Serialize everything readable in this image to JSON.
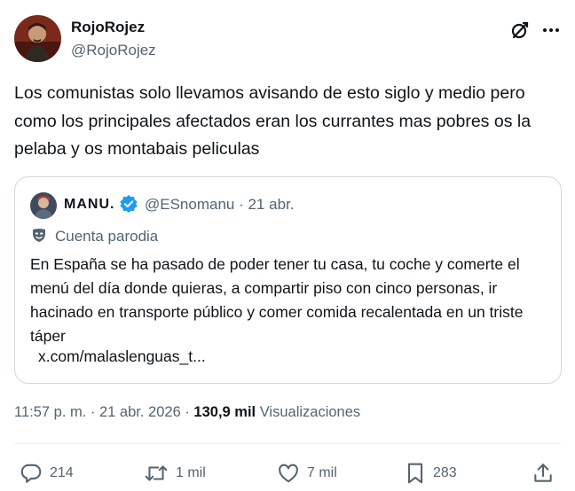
{
  "tweet": {
    "author": {
      "display_name": "RojoRojez",
      "handle": "@RojoRojez"
    },
    "text": "Los comunistas solo llevamos avisando de esto siglo y medio pero como los principales afectados eran los currantes mas pobres os la pelaba y os montabais peliculas",
    "quoted": {
      "display_name": "MANU.",
      "handle_time": "@ESnomanu · 21 abr.",
      "parody_label": "Cuenta parodia",
      "text": "En España se ha pasado de poder tener tu casa, tu coche y comerte el menú del día donde quieras, a compartir piso con cinco personas, ir hacinado en transporte público y comer comida recalentada en un triste táper",
      "link": "x.com/malaslenguas_t..."
    },
    "meta": {
      "time": "11:57 p. m.",
      "separator": " · ",
      "date": "21 abr. 2026",
      "views_count": "130,9 mil",
      "views_label": " Visualizaciones"
    },
    "actions": {
      "replies": "214",
      "reposts": "1 mil",
      "likes": "7 mil",
      "bookmarks": "283"
    }
  },
  "icons": {
    "grok": "grok-icon",
    "more": "more-dots-icon",
    "verified": "verified-badge-icon",
    "parody": "parody-mask-icon",
    "reply": "reply-icon",
    "repost": "repost-icon",
    "like": "heart-icon",
    "bookmark": "bookmark-icon",
    "share": "share-icon"
  },
  "colors": {
    "text": "#0f1419",
    "secondary": "#536471",
    "verified": "#1d9bf0",
    "border": "#cfd9de"
  }
}
